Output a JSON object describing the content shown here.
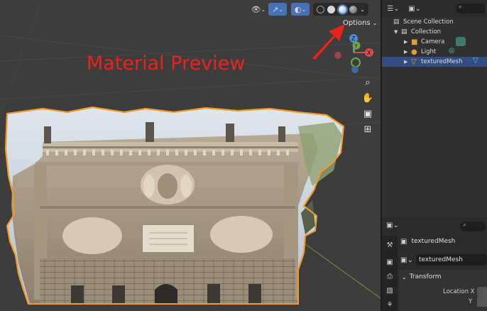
{
  "annotation": "Material Preview",
  "viewport": {
    "options_label": "Options",
    "shading_modes": [
      "Wireframe",
      "Solid",
      "Material Preview",
      "Rendered"
    ],
    "active_shading": "Material Preview"
  },
  "gizmo": {
    "axes": [
      "Z",
      "Y",
      "X"
    ]
  },
  "outliner": {
    "items": [
      {
        "label": "Scene Collection",
        "icon": "scene-collection-icon"
      },
      {
        "label": "Collection",
        "icon": "collection-icon"
      },
      {
        "label": "Camera",
        "icon": "camera-object-icon"
      },
      {
        "label": "Light",
        "icon": "light-object-icon"
      },
      {
        "label": "texturedMesh",
        "icon": "mesh-object-icon",
        "selected": true
      }
    ]
  },
  "properties": {
    "object_name": "texturedMesh",
    "object_name_field": "texturedMesh",
    "panel_title": "Transform",
    "location_x_label": "Location X",
    "location_y_label": "Y"
  },
  "colors": {
    "selection_outline": "#f39a2a",
    "annotation": "#e8231d",
    "selected_row": "#334d80"
  }
}
